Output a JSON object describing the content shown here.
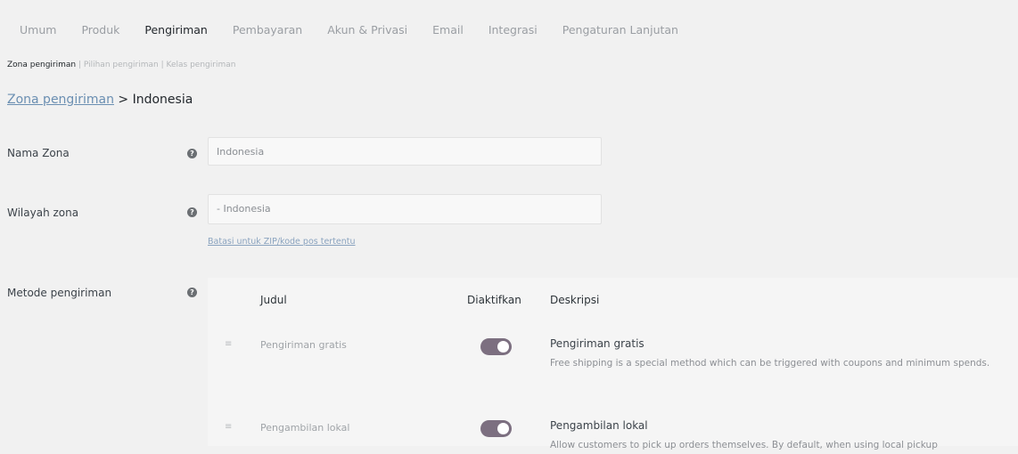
{
  "tabs": [
    {
      "label": "Umum"
    },
    {
      "label": "Produk"
    },
    {
      "label": "Pengiriman"
    },
    {
      "label": "Pembayaran"
    },
    {
      "label": "Akun & Privasi"
    },
    {
      "label": "Email"
    },
    {
      "label": "Integrasi"
    },
    {
      "label": "Pengaturan Lanjutan"
    }
  ],
  "subnav": {
    "current": "Zona pengiriman",
    "sep1": " | ",
    "options": "Pilihan pengiriman",
    "sep2": " | ",
    "classes": "Kelas pengiriman"
  },
  "breadcrumb": {
    "link": "Zona pengiriman",
    "separator": " > ",
    "current": "Indonesia"
  },
  "form": {
    "zone_name_label": "Nama Zona",
    "zone_name_value": "Indonesia",
    "region_label": "Wilayah zona",
    "region_value": "- Indonesia",
    "limit_link": "Batasi untuk ZIP/kode pos tertentu",
    "methods_label": "Metode pengiriman",
    "help_glyph": "?"
  },
  "methods_table": {
    "headers": {
      "title": "Judul",
      "enabled": "Diaktifkan",
      "description": "Deskripsi"
    },
    "rows": [
      {
        "handle": "≡",
        "title": "Pengiriman gratis",
        "enabled": true,
        "desc_title": "Pengiriman gratis",
        "desc_text": "Free shipping is a special method which can be triggered with coupons and minimum spends."
      },
      {
        "handle": "≡",
        "title": "Pengambilan lokal",
        "enabled": true,
        "desc_title": "Pengambilan lokal",
        "desc_text": "Allow customers to pick up orders themselves. By default, when using local pickup"
      }
    ]
  },
  "colors": {
    "toggle_on": "#7c6f80",
    "link": "#6b8fb2"
  }
}
